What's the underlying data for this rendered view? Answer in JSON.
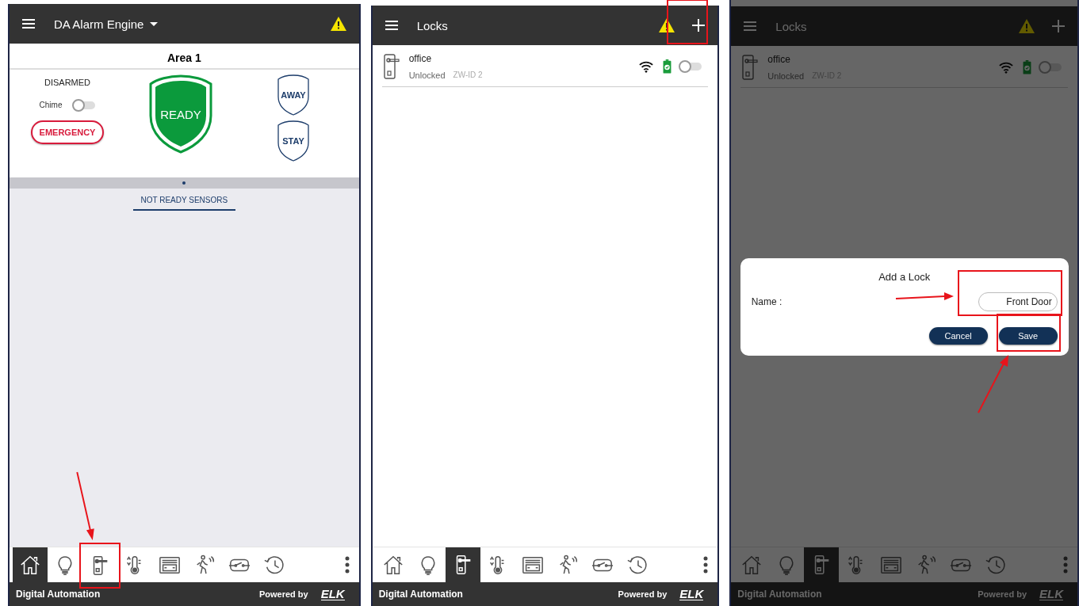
{
  "screens": [
    {
      "kind": "alarm",
      "dimmed": false,
      "app_bar": {
        "title": "DA Alarm Engine",
        "dropdown": true,
        "warning": true,
        "add": false,
        "add_highlighted": false
      },
      "area": {
        "title": "Area 1",
        "status": "DISARMED",
        "chime": {
          "label": "Chime",
          "on": false
        },
        "emergency": "EMERGENCY",
        "ready": "READY",
        "away": "AWAY",
        "stay": "STAY",
        "tab": "NOT READY SENSORS"
      },
      "nav": [
        {
          "kind": "home",
          "selected": true,
          "highlighted": false
        },
        {
          "kind": "light",
          "selected": false,
          "highlighted": false
        },
        {
          "kind": "lock",
          "selected": false,
          "highlighted": true
        },
        {
          "kind": "thermostat",
          "selected": false,
          "highlighted": false
        },
        {
          "kind": "garage",
          "selected": false,
          "highlighted": false
        },
        {
          "kind": "motion",
          "selected": false,
          "highlighted": false
        },
        {
          "kind": "switch",
          "selected": false,
          "highlighted": false
        },
        {
          "kind": "history",
          "selected": false,
          "highlighted": false
        }
      ],
      "footer": {
        "brand": "Digital Automation",
        "powered": "Powered by",
        "logo": "ELK"
      }
    },
    {
      "kind": "locks",
      "dimmed": false,
      "app_bar": {
        "title": "Locks",
        "dropdown": false,
        "warning": true,
        "add": true,
        "add_highlighted": true
      },
      "locks": [
        {
          "name": "office",
          "status": "Unlocked",
          "id": "ZW-ID 2",
          "on": false
        }
      ],
      "nav": [
        {
          "kind": "home",
          "selected": false,
          "highlighted": false
        },
        {
          "kind": "light",
          "selected": false,
          "highlighted": false
        },
        {
          "kind": "lock",
          "selected": true,
          "highlighted": false
        },
        {
          "kind": "thermostat",
          "selected": false,
          "highlighted": false
        },
        {
          "kind": "garage",
          "selected": false,
          "highlighted": false
        },
        {
          "kind": "motion",
          "selected": false,
          "highlighted": false
        },
        {
          "kind": "switch",
          "selected": false,
          "highlighted": false
        },
        {
          "kind": "history",
          "selected": false,
          "highlighted": false
        }
      ],
      "footer": {
        "brand": "Digital Automation",
        "powered": "Powered by",
        "logo": "ELK"
      }
    },
    {
      "kind": "locks",
      "dimmed": true,
      "app_bar": {
        "title": "Locks",
        "dropdown": false,
        "warning": true,
        "add": true,
        "add_highlighted": false
      },
      "locks": [
        {
          "name": "office",
          "status": "Unlocked",
          "id": "ZW-ID 2",
          "on": false
        }
      ],
      "dialog": {
        "title": "Add a Lock",
        "label": "Name :",
        "value": "Front Door",
        "value_highlighted": true,
        "cancel": "Cancel",
        "save": "Save",
        "save_highlighted": true
      },
      "nav": [
        {
          "kind": "home",
          "selected": false,
          "highlighted": false
        },
        {
          "kind": "light",
          "selected": false,
          "highlighted": false
        },
        {
          "kind": "lock",
          "selected": true,
          "highlighted": false
        },
        {
          "kind": "thermostat",
          "selected": false,
          "highlighted": false
        },
        {
          "kind": "garage",
          "selected": false,
          "highlighted": false
        },
        {
          "kind": "motion",
          "selected": false,
          "highlighted": false
        },
        {
          "kind": "switch",
          "selected": false,
          "highlighted": false
        },
        {
          "kind": "history",
          "selected": false,
          "highlighted": false
        }
      ],
      "footer": {
        "brand": "Digital Automation",
        "powered": "Powered by",
        "logo": "ELK"
      }
    }
  ]
}
